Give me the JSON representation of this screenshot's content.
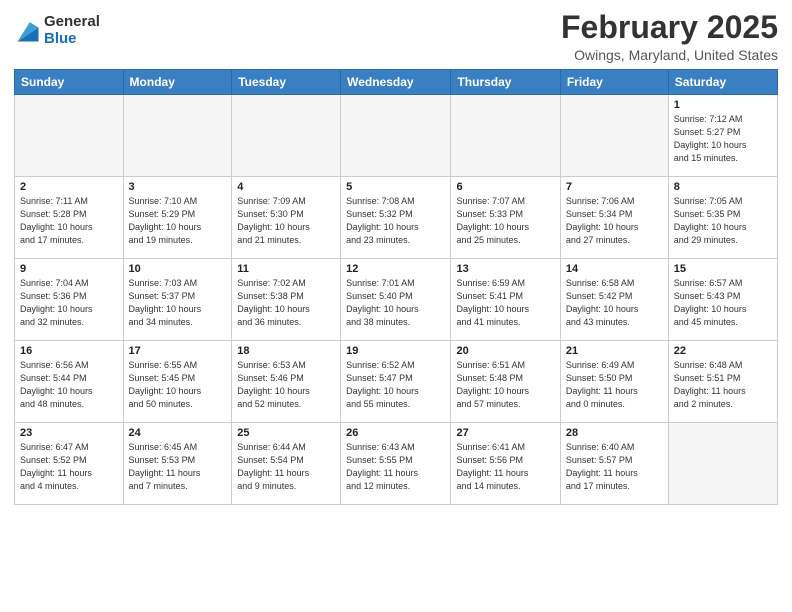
{
  "header": {
    "logo_general": "General",
    "logo_blue": "Blue",
    "month": "February 2025",
    "location": "Owings, Maryland, United States"
  },
  "weekdays": [
    "Sunday",
    "Monday",
    "Tuesday",
    "Wednesday",
    "Thursday",
    "Friday",
    "Saturday"
  ],
  "weeks": [
    [
      {
        "day": "",
        "info": ""
      },
      {
        "day": "",
        "info": ""
      },
      {
        "day": "",
        "info": ""
      },
      {
        "day": "",
        "info": ""
      },
      {
        "day": "",
        "info": ""
      },
      {
        "day": "",
        "info": ""
      },
      {
        "day": "1",
        "info": "Sunrise: 7:12 AM\nSunset: 5:27 PM\nDaylight: 10 hours\nand 15 minutes."
      }
    ],
    [
      {
        "day": "2",
        "info": "Sunrise: 7:11 AM\nSunset: 5:28 PM\nDaylight: 10 hours\nand 17 minutes."
      },
      {
        "day": "3",
        "info": "Sunrise: 7:10 AM\nSunset: 5:29 PM\nDaylight: 10 hours\nand 19 minutes."
      },
      {
        "day": "4",
        "info": "Sunrise: 7:09 AM\nSunset: 5:30 PM\nDaylight: 10 hours\nand 21 minutes."
      },
      {
        "day": "5",
        "info": "Sunrise: 7:08 AM\nSunset: 5:32 PM\nDaylight: 10 hours\nand 23 minutes."
      },
      {
        "day": "6",
        "info": "Sunrise: 7:07 AM\nSunset: 5:33 PM\nDaylight: 10 hours\nand 25 minutes."
      },
      {
        "day": "7",
        "info": "Sunrise: 7:06 AM\nSunset: 5:34 PM\nDaylight: 10 hours\nand 27 minutes."
      },
      {
        "day": "8",
        "info": "Sunrise: 7:05 AM\nSunset: 5:35 PM\nDaylight: 10 hours\nand 29 minutes."
      }
    ],
    [
      {
        "day": "9",
        "info": "Sunrise: 7:04 AM\nSunset: 5:36 PM\nDaylight: 10 hours\nand 32 minutes."
      },
      {
        "day": "10",
        "info": "Sunrise: 7:03 AM\nSunset: 5:37 PM\nDaylight: 10 hours\nand 34 minutes."
      },
      {
        "day": "11",
        "info": "Sunrise: 7:02 AM\nSunset: 5:38 PM\nDaylight: 10 hours\nand 36 minutes."
      },
      {
        "day": "12",
        "info": "Sunrise: 7:01 AM\nSunset: 5:40 PM\nDaylight: 10 hours\nand 38 minutes."
      },
      {
        "day": "13",
        "info": "Sunrise: 6:59 AM\nSunset: 5:41 PM\nDaylight: 10 hours\nand 41 minutes."
      },
      {
        "day": "14",
        "info": "Sunrise: 6:58 AM\nSunset: 5:42 PM\nDaylight: 10 hours\nand 43 minutes."
      },
      {
        "day": "15",
        "info": "Sunrise: 6:57 AM\nSunset: 5:43 PM\nDaylight: 10 hours\nand 45 minutes."
      }
    ],
    [
      {
        "day": "16",
        "info": "Sunrise: 6:56 AM\nSunset: 5:44 PM\nDaylight: 10 hours\nand 48 minutes."
      },
      {
        "day": "17",
        "info": "Sunrise: 6:55 AM\nSunset: 5:45 PM\nDaylight: 10 hours\nand 50 minutes."
      },
      {
        "day": "18",
        "info": "Sunrise: 6:53 AM\nSunset: 5:46 PM\nDaylight: 10 hours\nand 52 minutes."
      },
      {
        "day": "19",
        "info": "Sunrise: 6:52 AM\nSunset: 5:47 PM\nDaylight: 10 hours\nand 55 minutes."
      },
      {
        "day": "20",
        "info": "Sunrise: 6:51 AM\nSunset: 5:48 PM\nDaylight: 10 hours\nand 57 minutes."
      },
      {
        "day": "21",
        "info": "Sunrise: 6:49 AM\nSunset: 5:50 PM\nDaylight: 11 hours\nand 0 minutes."
      },
      {
        "day": "22",
        "info": "Sunrise: 6:48 AM\nSunset: 5:51 PM\nDaylight: 11 hours\nand 2 minutes."
      }
    ],
    [
      {
        "day": "23",
        "info": "Sunrise: 6:47 AM\nSunset: 5:52 PM\nDaylight: 11 hours\nand 4 minutes."
      },
      {
        "day": "24",
        "info": "Sunrise: 6:45 AM\nSunset: 5:53 PM\nDaylight: 11 hours\nand 7 minutes."
      },
      {
        "day": "25",
        "info": "Sunrise: 6:44 AM\nSunset: 5:54 PM\nDaylight: 11 hours\nand 9 minutes."
      },
      {
        "day": "26",
        "info": "Sunrise: 6:43 AM\nSunset: 5:55 PM\nDaylight: 11 hours\nand 12 minutes."
      },
      {
        "day": "27",
        "info": "Sunrise: 6:41 AM\nSunset: 5:56 PM\nDaylight: 11 hours\nand 14 minutes."
      },
      {
        "day": "28",
        "info": "Sunrise: 6:40 AM\nSunset: 5:57 PM\nDaylight: 11 hours\nand 17 minutes."
      },
      {
        "day": "",
        "info": ""
      }
    ]
  ]
}
